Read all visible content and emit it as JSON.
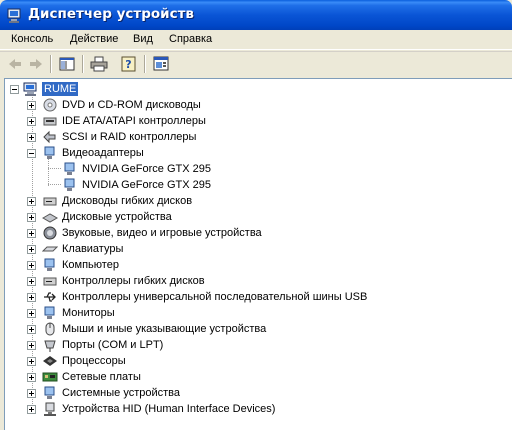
{
  "window": {
    "title": "Диспетчер устройств"
  },
  "menu": [
    {
      "label": "Консоль"
    },
    {
      "label": "Действие"
    },
    {
      "label": "Вид"
    },
    {
      "label": "Справка"
    }
  ],
  "toolbar": {
    "buttons": [
      "back-icon",
      "forward-icon",
      "show-hide-console-tree-icon",
      "print-icon",
      "help-icon",
      "properties-icon"
    ]
  },
  "tree": {
    "root": {
      "label": "RUME",
      "icon": "computer-icon",
      "expanded": true
    },
    "categories": [
      {
        "label": "DVD и CD-ROM дисководы",
        "icon": "dvd-drive-icon",
        "expanded": false
      },
      {
        "label": "IDE ATA/ATAPI контроллеры",
        "icon": "ide-controller-icon",
        "expanded": false
      },
      {
        "label": "SCSI и RAID контроллеры",
        "icon": "scsi-controller-icon",
        "expanded": false
      },
      {
        "label": "Видеоадаптеры",
        "icon": "display-adapter-icon",
        "expanded": true,
        "children": [
          {
            "label": "NVIDIA GeForce GTX 295"
          },
          {
            "label": "NVIDIA GeForce GTX 295"
          }
        ]
      },
      {
        "label": "Дисководы гибких дисков",
        "icon": "floppy-drive-icon",
        "expanded": false
      },
      {
        "label": "Дисковые устройства",
        "icon": "disk-drive-icon",
        "expanded": false
      },
      {
        "label": "Звуковые, видео и игровые устройства",
        "icon": "sound-icon",
        "expanded": false
      },
      {
        "label": "Клавиатуры",
        "icon": "keyboard-icon",
        "expanded": false
      },
      {
        "label": "Компьютер",
        "icon": "computer-small-icon",
        "expanded": false
      },
      {
        "label": "Контроллеры гибких дисков",
        "icon": "floppy-controller-icon",
        "expanded": false
      },
      {
        "label": "Контроллеры универсальной последовательной шины USB",
        "icon": "usb-icon",
        "expanded": false
      },
      {
        "label": "Мониторы",
        "icon": "monitor-icon",
        "expanded": false
      },
      {
        "label": "Мыши и иные указывающие устройства",
        "icon": "mouse-icon",
        "expanded": false
      },
      {
        "label": "Порты (COM и LPT)",
        "icon": "port-icon",
        "expanded": false
      },
      {
        "label": "Процессоры",
        "icon": "processor-icon",
        "expanded": false
      },
      {
        "label": "Сетевые платы",
        "icon": "network-card-icon",
        "expanded": false
      },
      {
        "label": "Системные устройства",
        "icon": "system-device-icon",
        "expanded": false
      },
      {
        "label": "Устройства HID (Human Interface Devices)",
        "icon": "hid-icon",
        "expanded": false
      }
    ]
  },
  "colors": {
    "titlebar": "#0a55d6",
    "selection": "#316ac5",
    "window_bg": "#ece9d8"
  }
}
